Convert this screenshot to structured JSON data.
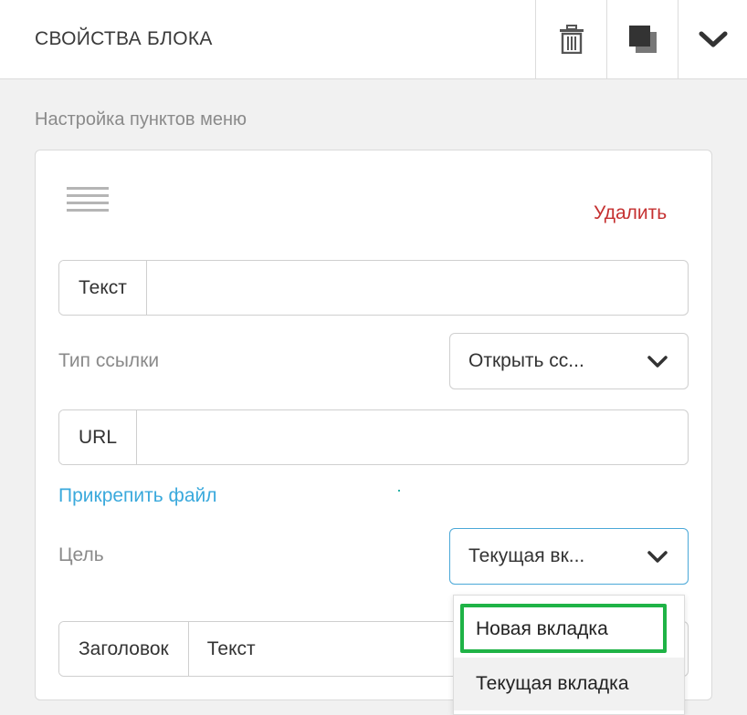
{
  "header": {
    "title": "СВОЙСТВА БЛОКА",
    "icons": [
      "trash-icon",
      "copy-icon",
      "chevron-down-icon"
    ]
  },
  "section": {
    "label": "Настройка пунктов меню"
  },
  "item": {
    "delete_label": "Удалить",
    "text_field": {
      "addon": "Текст",
      "value": ""
    },
    "link_type": {
      "label": "Тип ссылки",
      "value": "Открыть сс..."
    },
    "url_field": {
      "addon": "URL",
      "value": ""
    },
    "attach_label": "Прикрепить файл",
    "target": {
      "label": "Цель",
      "value": "Текущая вк..."
    },
    "title_field": {
      "addon": "Заголовок",
      "value": "Текст"
    }
  },
  "dropdown": {
    "options": [
      "Новая вкладка",
      "Текущая вкладка"
    ]
  },
  "colors": {
    "delete": "#c53030",
    "link": "#3aa9dc",
    "focus": "#4aa8d8",
    "highlight": "#1fb346"
  }
}
